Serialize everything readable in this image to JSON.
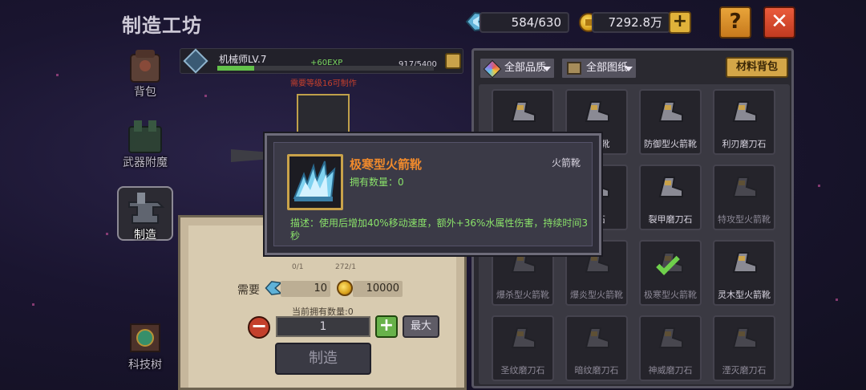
{
  "header": {
    "title": "制造工坊",
    "energy": "584/630",
    "gold": "7292.8万",
    "plus_label": "+",
    "help_label": "?",
    "close_label": "✕"
  },
  "nav": {
    "items": [
      {
        "label": "背包",
        "icon": "backpack-icon"
      },
      {
        "label": "武器附魔",
        "icon": "enchant-icon"
      },
      {
        "label": "制造",
        "icon": "anvil-icon",
        "active": true
      },
      {
        "label": "科技树",
        "icon": "tech-tree-icon"
      }
    ]
  },
  "level": {
    "name": "机械师LV.7",
    "xp_gain": "+60EXP",
    "progress": "917/5400",
    "fraction": 0.17,
    "requirement": "需要等级16可制作"
  },
  "craft": {
    "mat_count_1": "0/1",
    "mat_count_2": "272/1",
    "need_label": "需要",
    "need_energy": "10",
    "need_gold": "10000",
    "owned_text": "当前拥有数量:0",
    "minus_label": "−",
    "quantity": "1",
    "plus_label": "+",
    "max_label": "最大",
    "make_label": "制造"
  },
  "filters": {
    "quality": "全部品质",
    "plan": "全部图纸",
    "bag": "材料背包"
  },
  "grid": {
    "items": [
      {
        "label": "",
        "dim": false
      },
      {
        "label": "火箭靴",
        "dim": false
      },
      {
        "label": "防御型火箭靴",
        "dim": false
      },
      {
        "label": "利刃磨刀石",
        "dim": false
      },
      {
        "label": "",
        "dim": true
      },
      {
        "label": "刀石",
        "dim": false
      },
      {
        "label": "裂甲磨刀石",
        "dim": false
      },
      {
        "label": "特攻型火箭靴",
        "dim": true
      },
      {
        "label": "爆杀型火箭靴",
        "dim": true
      },
      {
        "label": "爆炎型火箭靴",
        "dim": true
      },
      {
        "label": "极寒型火箭靴",
        "dim": true,
        "checked": true
      },
      {
        "label": "灵木型火箭靴",
        "dim": false
      },
      {
        "label": "圣纹磨刀石",
        "dim": true
      },
      {
        "label": "暗纹磨刀石",
        "dim": true
      },
      {
        "label": "神威磨刀石",
        "dim": true
      },
      {
        "label": "湮灭磨刀石",
        "dim": true
      }
    ]
  },
  "popup": {
    "name": "极寒型火箭靴",
    "type": "火箭靴",
    "owned": "拥有数量：0",
    "description": "描述：使用后增加40%移动速度，额外+36%水属性伤害，持续时间3秒"
  },
  "colors": {
    "rarity_orange": "#f08a2c",
    "desc_green": "#8ae26a",
    "error_red": "#c6402c",
    "gold": "#e0b23a"
  }
}
